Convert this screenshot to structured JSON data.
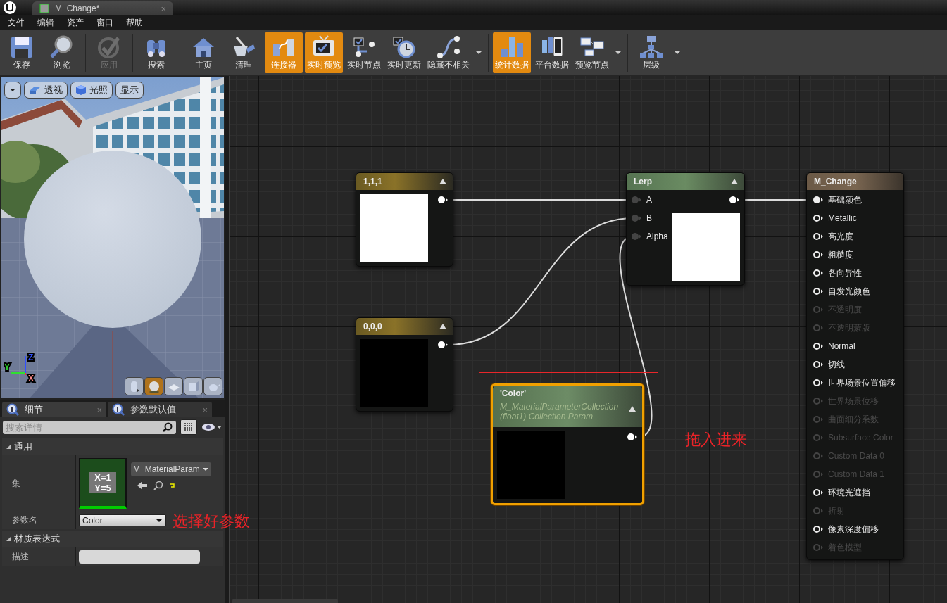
{
  "tab": {
    "label": "M_Change*",
    "close": "×"
  },
  "menu": [
    "文件",
    "编辑",
    "资产",
    "窗口",
    "帮助"
  ],
  "toolbar": [
    [
      {
        "kind": "save",
        "label": "保存",
        "active": false,
        "disabled": false,
        "dropdown": false
      },
      {
        "kind": "browse",
        "label": "浏览",
        "active": false,
        "disabled": false,
        "dropdown": false
      }
    ],
    [
      {
        "kind": "apply",
        "label": "应用",
        "active": false,
        "disabled": true,
        "dropdown": false
      }
    ],
    [
      {
        "kind": "search",
        "label": "搜索",
        "active": false,
        "disabled": false,
        "dropdown": false
      }
    ],
    [
      {
        "kind": "home",
        "label": "主页",
        "active": false,
        "disabled": false,
        "dropdown": false
      },
      {
        "kind": "clean",
        "label": "清理",
        "active": false,
        "disabled": false,
        "dropdown": false
      },
      {
        "kind": "connector",
        "label": "连接器",
        "active": true,
        "disabled": false,
        "dropdown": false
      },
      {
        "kind": "live-preview",
        "label": "实时预览",
        "active": true,
        "disabled": false,
        "dropdown": false
      },
      {
        "kind": "live-nodes",
        "label": "实时节点",
        "active": false,
        "disabled": false,
        "dropdown": false
      },
      {
        "kind": "live-update",
        "label": "实时更新",
        "active": false,
        "disabled": false,
        "dropdown": false
      },
      {
        "kind": "hide",
        "label": "隐藏不相关",
        "active": false,
        "disabled": false,
        "dropdown": true
      }
    ],
    [
      {
        "kind": "stats",
        "label": "统计数据",
        "active": true,
        "disabled": false,
        "dropdown": false
      },
      {
        "kind": "platform",
        "label": "平台数据",
        "active": false,
        "disabled": false,
        "dropdown": false
      },
      {
        "kind": "preview-node",
        "label": "预览节点",
        "active": false,
        "disabled": false,
        "dropdown": true
      }
    ],
    [
      {
        "kind": "hierarchy",
        "label": "层级",
        "active": false,
        "disabled": false,
        "dropdown": true
      }
    ]
  ],
  "viewport": {
    "controls": [
      {
        "kind": "menu"
      },
      {
        "kind": "perspective",
        "label": "透视"
      },
      {
        "kind": "lighting",
        "label": "光照"
      },
      {
        "kind": "show",
        "label": "显示"
      }
    ],
    "axes": [
      "Z",
      "Y",
      "X"
    ],
    "shapes": [
      {
        "kind": "cylinder",
        "selected": false
      },
      {
        "kind": "sphere",
        "selected": true
      },
      {
        "kind": "plane",
        "selected": false
      },
      {
        "kind": "cube",
        "selected": false
      },
      {
        "kind": "teapot",
        "selected": false
      }
    ]
  },
  "details": {
    "tabs": [
      {
        "label": "细节",
        "selected": true,
        "close": "×"
      },
      {
        "label": "参数默认值",
        "selected": false,
        "close": "×"
      }
    ],
    "search": {
      "placeholder": "搜索详情"
    },
    "sections": [
      {
        "title": "通用",
        "expanded": true,
        "rows": [
          {
            "kind": "asset",
            "label": "集",
            "thumbnail": [
              "X=1",
              "Y=5"
            ],
            "value": "M_MaterialParam"
          },
          {
            "kind": "combo",
            "label": "参数名",
            "value": "Color"
          }
        ]
      },
      {
        "title": "材质表达式",
        "expanded": true,
        "rows": [
          {
            "kind": "text",
            "label": "描述"
          }
        ]
      }
    ]
  },
  "graph": {
    "nodes": [
      {
        "kind": "constant",
        "title": "1,1,1",
        "color": "#ffffff",
        "selected": false
      },
      {
        "kind": "constant",
        "title": "0,0,0",
        "color": "#000000",
        "selected": false
      },
      {
        "kind": "lerp",
        "title": "Lerp",
        "color": "#ffffff",
        "selected": false,
        "inputs": [
          {
            "label": "A"
          },
          {
            "label": "B"
          },
          {
            "label": "Alpha"
          }
        ]
      },
      {
        "kind": "param",
        "title": "'Color'",
        "subtitle": "M_MaterialParameterCollection (float1) Collection Param",
        "color": "#000000",
        "selected": true
      },
      {
        "kind": "result",
        "title": "M_Change",
        "selected": false,
        "inputs": [
          {
            "label": "基础颜色",
            "enabled": true,
            "connected": true
          },
          {
            "label": "Metallic",
            "enabled": true,
            "connected": false
          },
          {
            "label": "高光度",
            "enabled": true,
            "connected": false
          },
          {
            "label": "粗糙度",
            "enabled": true,
            "connected": false
          },
          {
            "label": "各向异性",
            "enabled": true,
            "connected": false
          },
          {
            "label": "自发光颜色",
            "enabled": true,
            "connected": false
          },
          {
            "label": "不透明度",
            "enabled": false,
            "connected": false
          },
          {
            "label": "不透明蒙版",
            "enabled": false,
            "connected": false
          },
          {
            "label": "Normal",
            "enabled": true,
            "connected": false
          },
          {
            "label": "切线",
            "enabled": true,
            "connected": false
          },
          {
            "label": "世界场景位置偏移",
            "enabled": true,
            "connected": false
          },
          {
            "label": "世界场景位移",
            "enabled": false,
            "connected": false
          },
          {
            "label": "曲面细分乘数",
            "enabled": false,
            "connected": false
          },
          {
            "label": "Subsurface Color",
            "enabled": false,
            "connected": false
          },
          {
            "label": "Custom Data 0",
            "enabled": false,
            "connected": false
          },
          {
            "label": "Custom Data 1",
            "enabled": false,
            "connected": false
          },
          {
            "label": "环境光遮挡",
            "enabled": true,
            "connected": false
          },
          {
            "label": "折射",
            "enabled": false,
            "connected": false
          },
          {
            "label": "像素深度偏移",
            "enabled": true,
            "connected": false
          },
          {
            "label": "着色模型",
            "enabled": false,
            "connected": false
          }
        ]
      }
    ],
    "highlight_frame": true
  },
  "annotations": [
    "选择好参数",
    "拖入进来"
  ]
}
